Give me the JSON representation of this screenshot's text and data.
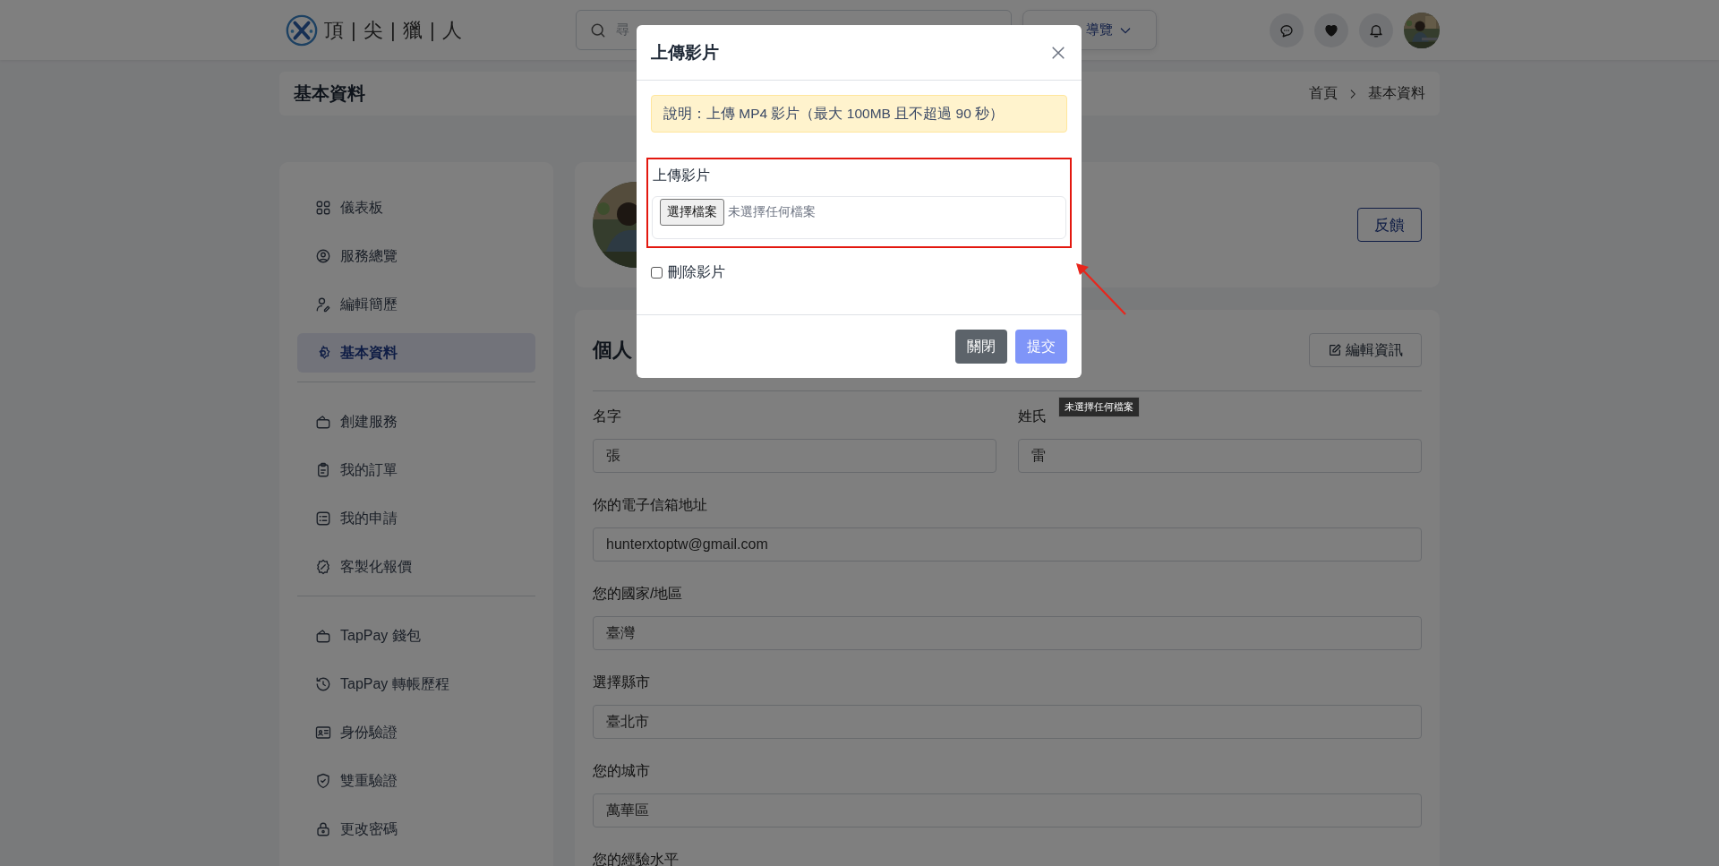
{
  "header": {
    "logo_text": "頂 | 尖 | 獵 | 人",
    "search": {
      "placeholder": "尋"
    },
    "nav_menu": {
      "label": "導覽"
    }
  },
  "page_title": "基本資料",
  "breadcrumb": [
    "首頁",
    "基本資料"
  ],
  "sidebar": {
    "groups": [
      [
        {
          "label": "儀表板",
          "selected": false
        },
        {
          "label": "服務總覽",
          "selected": false
        },
        {
          "label": "編輯簡歷",
          "selected": false
        },
        {
          "label": "基本資料",
          "selected": true
        }
      ],
      [
        {
          "label": "創建服務",
          "selected": false
        },
        {
          "label": "我的訂單",
          "selected": false
        },
        {
          "label": "我的申請",
          "selected": false
        },
        {
          "label": "客製化報價",
          "selected": false
        }
      ],
      [
        {
          "label": "TapPay 錢包",
          "selected": false
        },
        {
          "label": "TapPay 轉帳歷程",
          "selected": false
        },
        {
          "label": "身份驗證",
          "selected": false
        },
        {
          "label": "雙重驗證",
          "selected": false
        },
        {
          "label": "更改密碼",
          "selected": false
        }
      ]
    ]
  },
  "profile": {
    "feedback_button": "反饋"
  },
  "info_card": {
    "title": "個人",
    "edit_button": "編輯資訊",
    "fields": [
      {
        "kind": "half",
        "label": "名字",
        "value": "張"
      },
      {
        "kind": "half",
        "label": "姓氏",
        "value": "雷"
      },
      {
        "kind": "full",
        "label": "你的電子信箱地址",
        "value": "hunterxtoptw@gmail.com"
      },
      {
        "kind": "full",
        "label": "您的國家/地區",
        "value": "臺灣"
      },
      {
        "kind": "full",
        "label": "選擇縣市",
        "value": "臺北市"
      },
      {
        "kind": "full",
        "label": "您的城市",
        "value": "萬華區"
      },
      {
        "kind": "label",
        "label": "您的經驗水平"
      }
    ]
  },
  "modal": {
    "title": "上傳影片",
    "notice": "說明：上傳 MP4 影片（最大 100MB 且不超過 90 秒）",
    "upload": {
      "label": "上傳影片",
      "button": "選擇檔案",
      "status": "未選擇任何檔案"
    },
    "delete_video": {
      "label": "刪除影片",
      "checked": false
    },
    "buttons": [
      {
        "kind": "secondary",
        "label": "關閉",
        "disabled": false
      },
      {
        "kind": "primary",
        "label": "提交",
        "disabled": true
      }
    ]
  },
  "tooltip": "未選擇任何檔案"
}
